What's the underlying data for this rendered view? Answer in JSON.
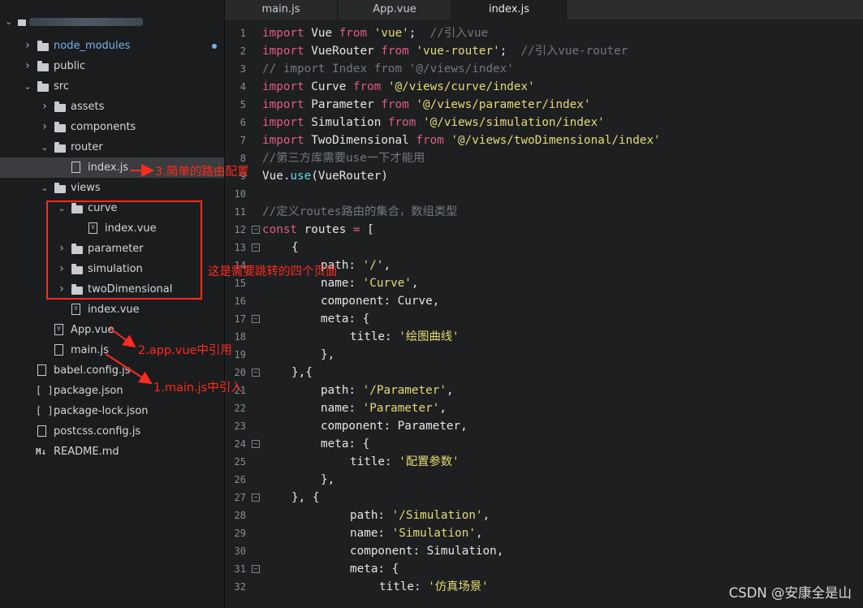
{
  "sidebar": {
    "items": [
      {
        "label": "node_modules",
        "type": "folder",
        "depth": 1,
        "expanded": false,
        "modified": true
      },
      {
        "label": "public",
        "type": "folder",
        "depth": 1,
        "expanded": false
      },
      {
        "label": "src",
        "type": "folder",
        "depth": 1,
        "expanded": true
      },
      {
        "label": "assets",
        "type": "folder",
        "depth": 2,
        "expanded": false
      },
      {
        "label": "components",
        "type": "folder",
        "depth": 2,
        "expanded": false
      },
      {
        "label": "router",
        "type": "folder",
        "depth": 2,
        "expanded": true
      },
      {
        "label": "index.js",
        "type": "js",
        "depth": 3,
        "selected": true
      },
      {
        "label": "views",
        "type": "folder",
        "depth": 2,
        "expanded": true
      },
      {
        "label": "curve",
        "type": "folder",
        "depth": 3,
        "expanded": true
      },
      {
        "label": "index.vue",
        "type": "vue",
        "depth": 4
      },
      {
        "label": "parameter",
        "type": "folder",
        "depth": 3,
        "expanded": false
      },
      {
        "label": "simulation",
        "type": "folder",
        "depth": 3,
        "expanded": false
      },
      {
        "label": "twoDimensional",
        "type": "folder",
        "depth": 3,
        "expanded": false
      },
      {
        "label": "index.vue",
        "type": "vue",
        "depth": 3
      },
      {
        "label": "App.vue",
        "type": "vue",
        "depth": 2
      },
      {
        "label": "main.js",
        "type": "js",
        "depth": 2
      },
      {
        "label": "babel.config.js",
        "type": "js",
        "depth": 1
      },
      {
        "label": "package.json",
        "type": "json",
        "depth": 1
      },
      {
        "label": "package-lock.json",
        "type": "json",
        "depth": 1
      },
      {
        "label": "postcss.config.js",
        "type": "js",
        "depth": 1
      },
      {
        "label": "README.md",
        "type": "md",
        "depth": 1
      }
    ]
  },
  "tabs": [
    {
      "label": "main.js",
      "active": false
    },
    {
      "label": "App.vue",
      "active": false
    },
    {
      "label": "index.js",
      "active": true
    }
  ],
  "editor": {
    "lines": [
      {
        "n": 1,
        "indent": 0,
        "tokens": [
          [
            "kw",
            "import"
          ],
          [
            "pl",
            " Vue "
          ],
          [
            "kw",
            "from"
          ],
          [
            "pl",
            " "
          ],
          [
            "str",
            "'vue'"
          ],
          [
            "pl",
            ";  "
          ],
          [
            "cm",
            "//引入vue"
          ]
        ]
      },
      {
        "n": 2,
        "indent": 0,
        "tokens": [
          [
            "kw",
            "import"
          ],
          [
            "pl",
            " VueRouter "
          ],
          [
            "kw",
            "from"
          ],
          [
            "pl",
            " "
          ],
          [
            "str",
            "'vue-router'"
          ],
          [
            "pl",
            ";  "
          ],
          [
            "cm",
            "//引入vue-router"
          ]
        ]
      },
      {
        "n": 3,
        "indent": 0,
        "tokens": [
          [
            "cm",
            "// import Index from '@/views/index'"
          ]
        ]
      },
      {
        "n": 4,
        "indent": 0,
        "tokens": [
          [
            "kw",
            "import"
          ],
          [
            "pl",
            " Curve "
          ],
          [
            "kw",
            "from"
          ],
          [
            "pl",
            " "
          ],
          [
            "str",
            "'@/views/curve/index'"
          ]
        ]
      },
      {
        "n": 5,
        "indent": 0,
        "tokens": [
          [
            "kw",
            "import"
          ],
          [
            "pl",
            " Parameter "
          ],
          [
            "kw",
            "from"
          ],
          [
            "pl",
            " "
          ],
          [
            "str",
            "'@/views/parameter/index'"
          ]
        ]
      },
      {
        "n": 6,
        "indent": 0,
        "tokens": [
          [
            "kw",
            "import"
          ],
          [
            "pl",
            " Simulation "
          ],
          [
            "kw",
            "from"
          ],
          [
            "pl",
            " "
          ],
          [
            "str",
            "'@/views/simulation/index'"
          ]
        ]
      },
      {
        "n": 7,
        "indent": 0,
        "tokens": [
          [
            "kw",
            "import"
          ],
          [
            "pl",
            " TwoDimensional "
          ],
          [
            "kw",
            "from"
          ],
          [
            "pl",
            " "
          ],
          [
            "str",
            "'@/views/twoDimensional/index'"
          ]
        ]
      },
      {
        "n": 8,
        "indent": 0,
        "tokens": [
          [
            "cm",
            "//第三方库需要use一下才能用"
          ]
        ]
      },
      {
        "n": 9,
        "indent": 0,
        "tokens": [
          [
            "pl",
            "Vue."
          ],
          [
            "fn",
            "use"
          ],
          [
            "pl",
            "(VueRouter)"
          ]
        ]
      },
      {
        "n": 10,
        "indent": 0,
        "tokens": []
      },
      {
        "n": 11,
        "indent": 0,
        "tokens": [
          [
            "cm",
            "//定义routes路由的集合，数组类型"
          ]
        ]
      },
      {
        "n": 12,
        "indent": 0,
        "fold": true,
        "tokens": [
          [
            "kw",
            "const"
          ],
          [
            "pl",
            " routes "
          ],
          [
            "kw",
            "="
          ],
          [
            "pl",
            " ["
          ]
        ]
      },
      {
        "n": 13,
        "indent": 1,
        "fold": true,
        "tokens": [
          [
            "pl",
            "{"
          ]
        ]
      },
      {
        "n": 14,
        "indent": 2,
        "tokens": [
          [
            "pl",
            "path: "
          ],
          [
            "str",
            "'/'"
          ],
          [
            "pl",
            ","
          ]
        ]
      },
      {
        "n": 15,
        "indent": 2,
        "tokens": [
          [
            "pl",
            "name: "
          ],
          [
            "str",
            "'Curve'"
          ],
          [
            "pl",
            ","
          ]
        ]
      },
      {
        "n": 16,
        "indent": 2,
        "tokens": [
          [
            "pl",
            "component: Curve,"
          ]
        ]
      },
      {
        "n": 17,
        "indent": 2,
        "fold": true,
        "tokens": [
          [
            "pl",
            "meta: {"
          ]
        ]
      },
      {
        "n": 18,
        "indent": 3,
        "tokens": [
          [
            "pl",
            "title: "
          ],
          [
            "str",
            "'绘图曲线'"
          ]
        ]
      },
      {
        "n": 19,
        "indent": 2,
        "tokens": [
          [
            "pl",
            "},"
          ]
        ]
      },
      {
        "n": 20,
        "indent": 1,
        "fold": true,
        "tokens": [
          [
            "pl",
            "},{"
          ]
        ]
      },
      {
        "n": 21,
        "indent": 2,
        "tokens": [
          [
            "pl",
            "path: "
          ],
          [
            "str",
            "'/Parameter'"
          ],
          [
            "pl",
            ","
          ]
        ]
      },
      {
        "n": 22,
        "indent": 2,
        "tokens": [
          [
            "pl",
            "name: "
          ],
          [
            "str",
            "'Parameter'"
          ],
          [
            "pl",
            ","
          ]
        ]
      },
      {
        "n": 23,
        "indent": 2,
        "tokens": [
          [
            "pl",
            "component: Parameter,"
          ]
        ]
      },
      {
        "n": 24,
        "indent": 2,
        "fold": true,
        "tokens": [
          [
            "pl",
            "meta: {"
          ]
        ]
      },
      {
        "n": 25,
        "indent": 3,
        "tokens": [
          [
            "pl",
            "title: "
          ],
          [
            "str",
            "'配置参数'"
          ]
        ]
      },
      {
        "n": 26,
        "indent": 2,
        "tokens": [
          [
            "pl",
            "},"
          ]
        ]
      },
      {
        "n": 27,
        "indent": 1,
        "fold": true,
        "tokens": [
          [
            "pl",
            "}, {"
          ]
        ]
      },
      {
        "n": 28,
        "indent": 3,
        "tokens": [
          [
            "pl",
            "path: "
          ],
          [
            "str",
            "'/Simulation'"
          ],
          [
            "pl",
            ","
          ]
        ]
      },
      {
        "n": 29,
        "indent": 3,
        "tokens": [
          [
            "pl",
            "name: "
          ],
          [
            "str",
            "'Simulation'"
          ],
          [
            "pl",
            ","
          ]
        ]
      },
      {
        "n": 30,
        "indent": 3,
        "tokens": [
          [
            "pl",
            "component: Simulation,"
          ]
        ]
      },
      {
        "n": 31,
        "indent": 3,
        "fold": true,
        "tokens": [
          [
            "pl",
            "meta: {"
          ]
        ]
      },
      {
        "n": 32,
        "indent": 4,
        "tokens": [
          [
            "pl",
            "title: "
          ],
          [
            "str",
            "'仿真场景'"
          ]
        ]
      }
    ]
  },
  "annotations": {
    "router": "3.简单的路由配置",
    "views": "这是需要跳转的四个页面",
    "app": "2.app.vue中引用",
    "main": "1.main.js中引入"
  },
  "watermark": "CSDN @安康全是山",
  "colors": {
    "annotation": "#ff2a1f",
    "keyword": "#e25a86",
    "string": "#e6db74",
    "comment": "#73787e",
    "function": "#66d9ef"
  }
}
